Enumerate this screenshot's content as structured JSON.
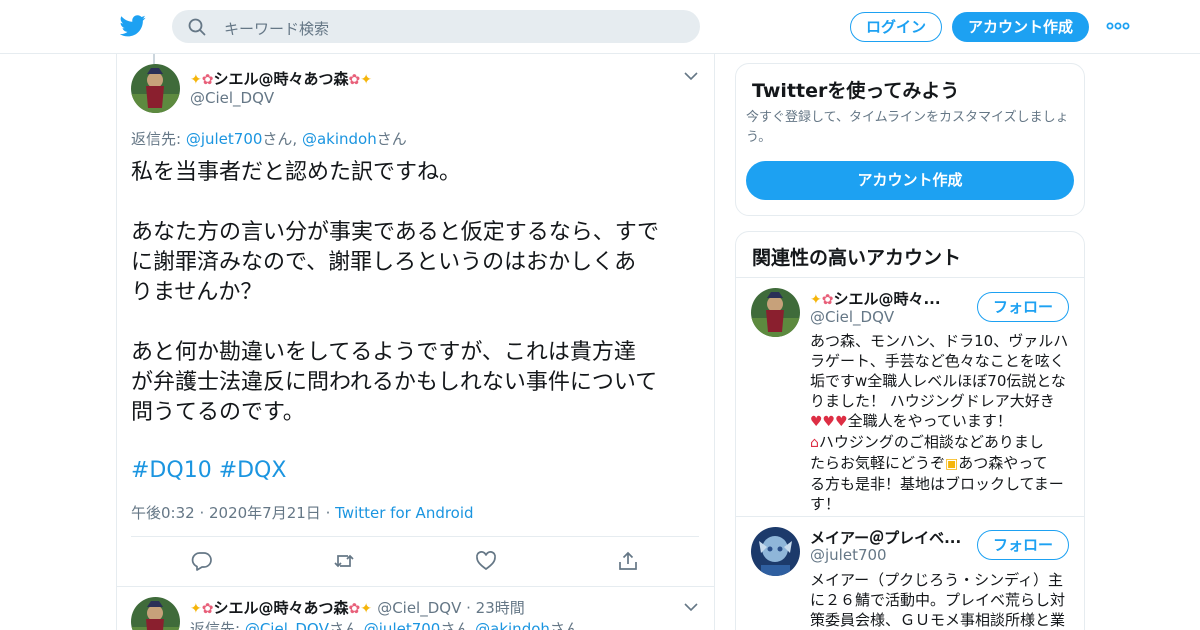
{
  "header": {
    "search_placeholder": "キーワード検索",
    "login_label": "ログイン",
    "signup_label": "アカウント作成"
  },
  "tweet": {
    "name": "シエル@時々あつ森",
    "handle": "@Ciel_DQV",
    "reply_prefix": "返信先: ",
    "reply_user1": "@julet700",
    "reply_sep": "さん, ",
    "reply_user2": "@akindoh",
    "reply_suffix": "さん",
    "text_lines": [
      "私を当事者だと認めた訳ですね。",
      "",
      "あなた方の言い分が事実であると仮定するなら、すで",
      "に謝罪済みなので、謝罪しろというのはおかしくあ",
      "りませんか？",
      "",
      "あと何か勘違いをしてるようですが、これは貴方達",
      "が弁護士法違反に問われるかもしれない事件について",
      "問うてるのです。"
    ],
    "hashtag1": "#DQ10",
    "hashtag2": "#DQX",
    "time": "午後0:32",
    "date": "2020年7月21日",
    "source": "Twitter for Android"
  },
  "next_tweet": {
    "name": "シエル@時々あつ森",
    "handle": "@Ciel_DQV",
    "age": "23時間",
    "reply_prefix": "返信先: ",
    "reply_user1": "@Ciel_DQV",
    "reply_user2": "@julet700",
    "reply_user3": "@akindoh",
    "reply_sep": "さん ",
    "reply_suffix": "さん"
  },
  "signup_card": {
    "title": "Twitterを使ってみよう",
    "desc": "今すぐ登録して、タイムラインをカスタマイズしましょう。",
    "button": "アカウント作成"
  },
  "related": {
    "title": "関連性の高いアカウント",
    "follow_label": "フォロー",
    "accounts": [
      {
        "name": "シエル@時々...",
        "handle": "@Ciel_DQV",
        "bio_lines": [
          "あつ森、モンハン、ドラ10、ヴァルハ",
          "ラゲート、手芸など色々なことを呟く",
          "垢ですw全職人レベルほぼ70伝説とな",
          "りました！ ハウジングドレア大好き",
          "全職人をやっています！",
          "ハウジングのご相談などありまし",
          "たらお気軽にどうぞ",
          "あつ森やって",
          "る方も是非！基地はブロックしてまー",
          "す！"
        ]
      },
      {
        "name": "メイアー＠プレイベ...",
        "handle": "@julet700",
        "bio_lines": [
          "メイアー（プクじろう・シンディ）主",
          "に２６鯖で活動中。プレイベ荒らし対",
          "策委員会様、ＧＵモメ事相談所様と業"
        ]
      }
    ]
  },
  "colors": {
    "accent": "#1da1f2",
    "link": "#1b95e0",
    "muted": "#657786",
    "border": "#e6ecf0"
  }
}
